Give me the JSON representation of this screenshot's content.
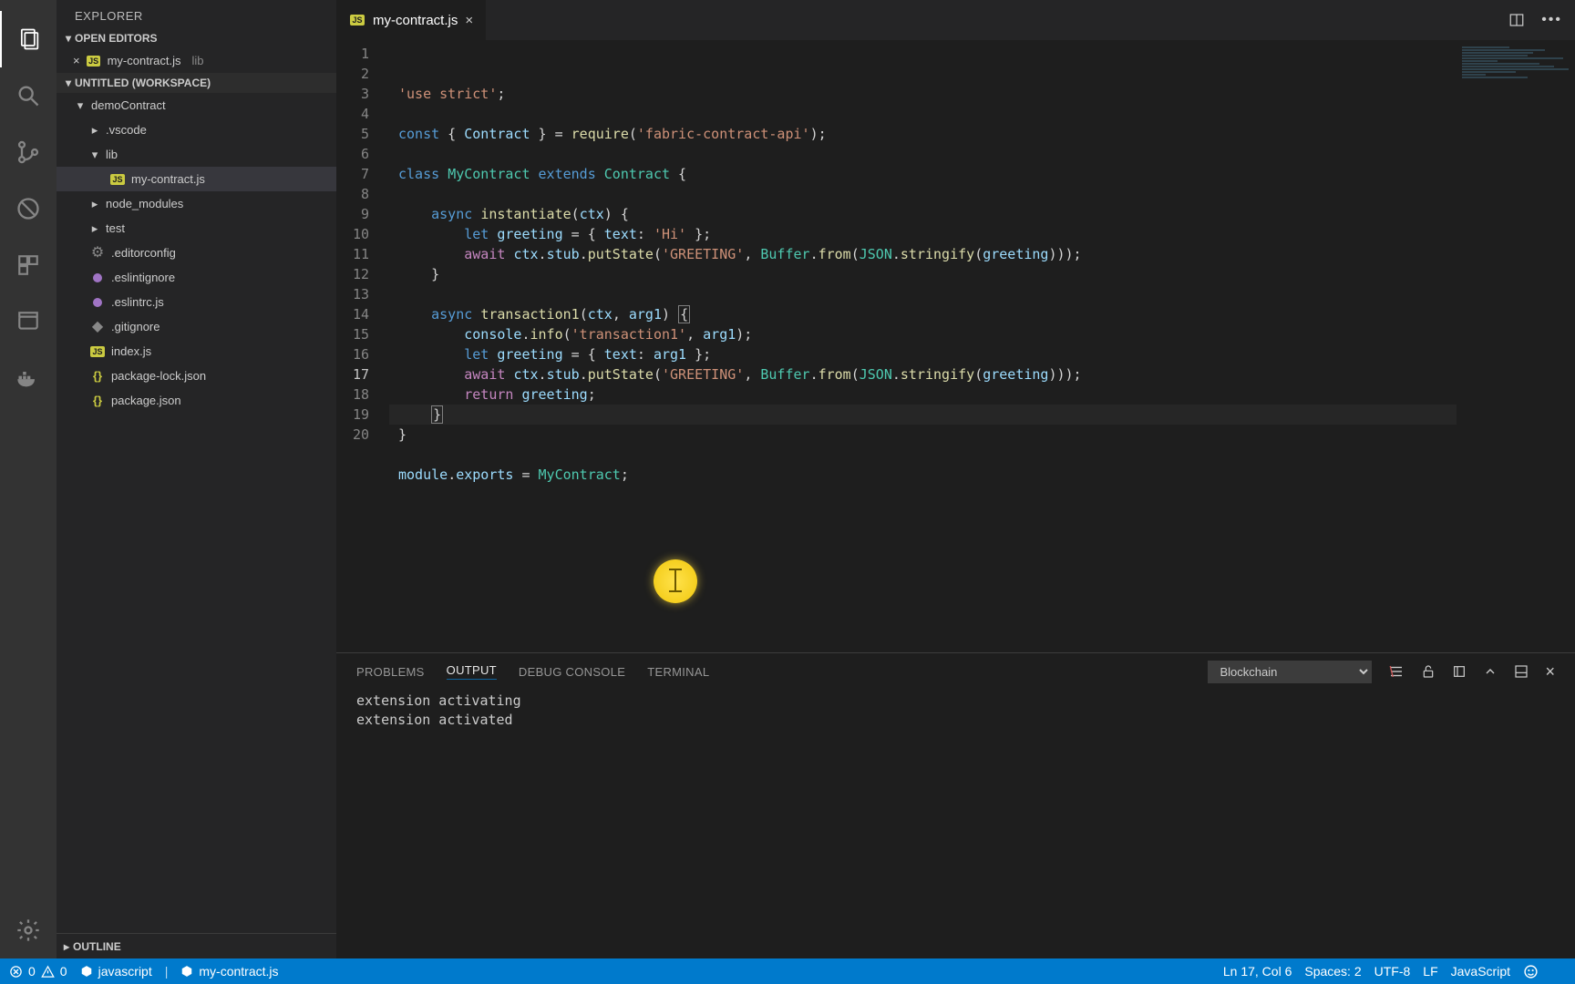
{
  "explorer": {
    "title": "EXPLORER"
  },
  "sections": {
    "open_editors": "OPEN EDITORS",
    "workspace": "UNTITLED (WORKSPACE)",
    "outline": "OUTLINE"
  },
  "open_editor": {
    "name": "my-contract.js",
    "hint": "lib"
  },
  "tree": {
    "root": "demoContract",
    "vscode": ".vscode",
    "lib": "lib",
    "file_active": "my-contract.js",
    "node_modules": "node_modules",
    "test": "test",
    "editorconfig": ".editorconfig",
    "eslintignore": ".eslintignore",
    "eslintrc": ".eslintrc.js",
    "gitignore": ".gitignore",
    "index": "index.js",
    "pkglock": "package-lock.json",
    "pkg": "package.json"
  },
  "tab": {
    "name": "my-contract.js"
  },
  "code_lines": [
    [
      [
        "str",
        "'use strict'"
      ],
      [
        "pl",
        ";"
      ]
    ],
    [],
    [
      [
        "kw",
        "const"
      ],
      [
        "pl",
        " { "
      ],
      [
        "var",
        "Contract"
      ],
      [
        "pl",
        " } = "
      ],
      [
        "fn",
        "require"
      ],
      [
        "pl",
        "("
      ],
      [
        "str",
        "'fabric-contract-api'"
      ],
      [
        "pl",
        ");"
      ]
    ],
    [],
    [
      [
        "kw",
        "class"
      ],
      [
        "pl",
        " "
      ],
      [
        "cls",
        "MyContract"
      ],
      [
        "pl",
        " "
      ],
      [
        "kw",
        "extends"
      ],
      [
        "pl",
        " "
      ],
      [
        "cls",
        "Contract"
      ],
      [
        "pl",
        " {"
      ]
    ],
    [],
    [
      [
        "pl",
        "    "
      ],
      [
        "kw",
        "async"
      ],
      [
        "pl",
        " "
      ],
      [
        "fn",
        "instantiate"
      ],
      [
        "pl",
        "("
      ],
      [
        "var",
        "ctx"
      ],
      [
        "pl",
        ") {"
      ]
    ],
    [
      [
        "pl",
        "        "
      ],
      [
        "kw",
        "let"
      ],
      [
        "pl",
        " "
      ],
      [
        "var",
        "greeting"
      ],
      [
        "pl",
        " = { "
      ],
      [
        "var",
        "text"
      ],
      [
        "pl",
        ": "
      ],
      [
        "str",
        "'Hi'"
      ],
      [
        "pl",
        " };"
      ]
    ],
    [
      [
        "pl",
        "        "
      ],
      [
        "ctrl",
        "await"
      ],
      [
        "pl",
        " "
      ],
      [
        "var",
        "ctx"
      ],
      [
        "pl",
        "."
      ],
      [
        "var",
        "stub"
      ],
      [
        "pl",
        "."
      ],
      [
        "fn",
        "putState"
      ],
      [
        "pl",
        "("
      ],
      [
        "str",
        "'GREETING'"
      ],
      [
        "pl",
        ", "
      ],
      [
        "cls",
        "Buffer"
      ],
      [
        "pl",
        "."
      ],
      [
        "fn",
        "from"
      ],
      [
        "pl",
        "("
      ],
      [
        "cls",
        "JSON"
      ],
      [
        "pl",
        "."
      ],
      [
        "fn",
        "stringify"
      ],
      [
        "pl",
        "("
      ],
      [
        "var",
        "greeting"
      ],
      [
        "pl",
        ")));"
      ]
    ],
    [
      [
        "pl",
        "    }"
      ]
    ],
    [],
    [
      [
        "pl",
        "    "
      ],
      [
        "kw",
        "async"
      ],
      [
        "pl",
        " "
      ],
      [
        "fn",
        "transaction1"
      ],
      [
        "pl",
        "("
      ],
      [
        "var",
        "ctx"
      ],
      [
        "pl",
        ", "
      ],
      [
        "var",
        "arg1"
      ],
      [
        "pl",
        ") "
      ],
      [
        "box",
        "{"
      ]
    ],
    [
      [
        "pl",
        "        "
      ],
      [
        "var",
        "console"
      ],
      [
        "pl",
        "."
      ],
      [
        "fn",
        "info"
      ],
      [
        "pl",
        "("
      ],
      [
        "str",
        "'transaction1'"
      ],
      [
        "pl",
        ", "
      ],
      [
        "var",
        "arg1"
      ],
      [
        "pl",
        ");"
      ]
    ],
    [
      [
        "pl",
        "        "
      ],
      [
        "kw",
        "let"
      ],
      [
        "pl",
        " "
      ],
      [
        "var",
        "greeting"
      ],
      [
        "pl",
        " = { "
      ],
      [
        "var",
        "text"
      ],
      [
        "pl",
        ": "
      ],
      [
        "var",
        "arg1"
      ],
      [
        "pl",
        " };"
      ]
    ],
    [
      [
        "pl",
        "        "
      ],
      [
        "ctrl",
        "await"
      ],
      [
        "pl",
        " "
      ],
      [
        "var",
        "ctx"
      ],
      [
        "pl",
        "."
      ],
      [
        "var",
        "stub"
      ],
      [
        "pl",
        "."
      ],
      [
        "fn",
        "putState"
      ],
      [
        "pl",
        "("
      ],
      [
        "str",
        "'GREETING'"
      ],
      [
        "pl",
        ", "
      ],
      [
        "cls",
        "Buffer"
      ],
      [
        "pl",
        "."
      ],
      [
        "fn",
        "from"
      ],
      [
        "pl",
        "("
      ],
      [
        "cls",
        "JSON"
      ],
      [
        "pl",
        "."
      ],
      [
        "fn",
        "stringify"
      ],
      [
        "pl",
        "("
      ],
      [
        "var",
        "greeting"
      ],
      [
        "pl",
        ")));"
      ]
    ],
    [
      [
        "pl",
        "        "
      ],
      [
        "ctrl",
        "return"
      ],
      [
        "pl",
        " "
      ],
      [
        "var",
        "greeting"
      ],
      [
        "pl",
        ";"
      ]
    ],
    [
      [
        "pl",
        "    "
      ],
      [
        "box",
        "}"
      ]
    ],
    [
      [
        "pl",
        "}"
      ]
    ],
    [],
    [
      [
        "var",
        "module"
      ],
      [
        "pl",
        "."
      ],
      [
        "var",
        "exports"
      ],
      [
        "pl",
        " = "
      ],
      [
        "cls",
        "MyContract"
      ],
      [
        "pl",
        ";"
      ]
    ]
  ],
  "current_line": 17,
  "panel": {
    "tabs": {
      "problems": "PROBLEMS",
      "output": "OUTPUT",
      "debug": "DEBUG CONSOLE",
      "terminal": "TERMINAL"
    },
    "select": "Blockchain",
    "lines": [
      "extension activating",
      "extension activated"
    ]
  },
  "status": {
    "errors": "0",
    "warnings": "0",
    "lang_left": "javascript",
    "file_left": "my-contract.js",
    "lncol": "Ln 17, Col 6",
    "spaces": "Spaces: 2",
    "encoding": "UTF-8",
    "eol": "LF",
    "language": "JavaScript"
  }
}
